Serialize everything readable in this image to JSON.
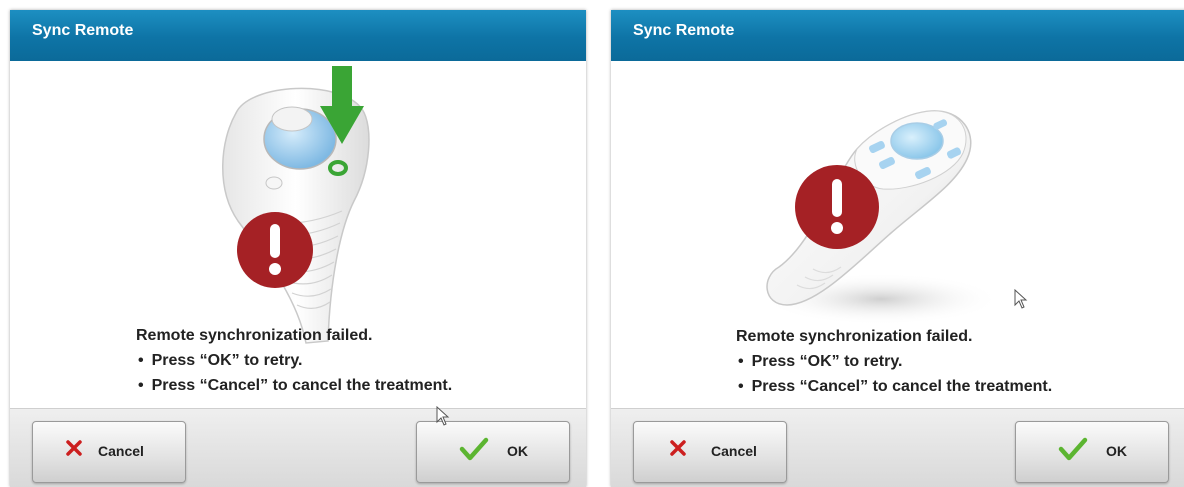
{
  "dialogs": [
    {
      "title": "Sync Remote",
      "message": "Remote synchronization failed.",
      "bullets": [
        "Press “OK” to retry.",
        "Press “Cancel” to cancel the treatment."
      ],
      "cancel_label": "Cancel",
      "ok_label": "OK"
    },
    {
      "title": "Sync Remote",
      "message": "Remote synchronization failed.",
      "bullets": [
        "Press “OK” to retry.",
        "Press “Cancel” to cancel the treatment."
      ],
      "cancel_label": "Cancel",
      "ok_label": "OK"
    }
  ],
  "colors": {
    "title_bar": "#0e74a6",
    "error_badge": "#a52125",
    "arrow_green": "#3aa535",
    "cancel_x": "#cc1f1f",
    "ok_check": "#5cb531"
  },
  "icons": {
    "error": "exclamation-circle-icon",
    "arrow": "arrow-down-icon",
    "cancel": "x-icon",
    "ok": "checkmark-icon",
    "cursor": "mouse-pointer-icon"
  }
}
